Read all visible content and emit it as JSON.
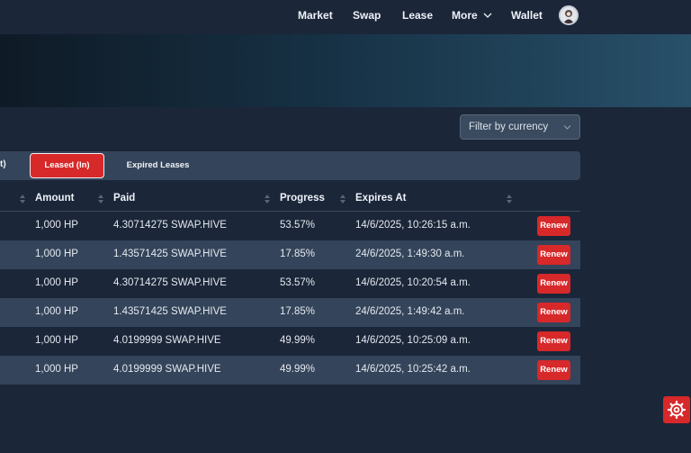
{
  "nav": {
    "items": [
      {
        "label": "Market"
      },
      {
        "label": "Swap"
      },
      {
        "label": "Lease"
      },
      {
        "label": "More"
      },
      {
        "label": "Wallet"
      }
    ]
  },
  "filter": {
    "label": "Filter by currency"
  },
  "tabs": {
    "cut_label": "t)",
    "active_label": "Leased (In)",
    "expired_label": "Expired Leases"
  },
  "table": {
    "headers": [
      "Amount",
      "Paid",
      "Progress",
      "Expires At"
    ],
    "rows": [
      {
        "amount": "1,000 HP",
        "paid": "4.30714275 SWAP.HIVE",
        "progress": "53.57%",
        "expires": "14/6/2025, 10:26:15 a.m.",
        "action": "Renew"
      },
      {
        "amount": "1,000 HP",
        "paid": "1.43571425 SWAP.HIVE",
        "progress": "17.85%",
        "expires": "24/6/2025, 1:49:30 a.m.",
        "action": "Renew"
      },
      {
        "amount": "1,000 HP",
        "paid": "4.30714275 SWAP.HIVE",
        "progress": "53.57%",
        "expires": "14/6/2025, 10:20:54 a.m.",
        "action": "Renew"
      },
      {
        "amount": "1,000 HP",
        "paid": "1.43571425 SWAP.HIVE",
        "progress": "17.85%",
        "expires": "24/6/2025, 1:49:42 a.m.",
        "action": "Renew"
      },
      {
        "amount": "1,000 HP",
        "paid": "4.0199999 SWAP.HIVE",
        "progress": "49.99%",
        "expires": "14/6/2025, 10:25:09 a.m.",
        "action": "Renew"
      },
      {
        "amount": "1,000 HP",
        "paid": "4.0199999 SWAP.HIVE",
        "progress": "49.99%",
        "expires": "14/6/2025, 10:25:42 a.m.",
        "action": "Renew"
      }
    ]
  },
  "colors": {
    "accent": "#d7282a",
    "background": "#1b2639",
    "row_alt": "#34445a"
  },
  "icons": {
    "more": "chevron-down-icon",
    "filter": "chevron-down-icon",
    "settings": "gear-icon",
    "sort": "sort-icon"
  }
}
